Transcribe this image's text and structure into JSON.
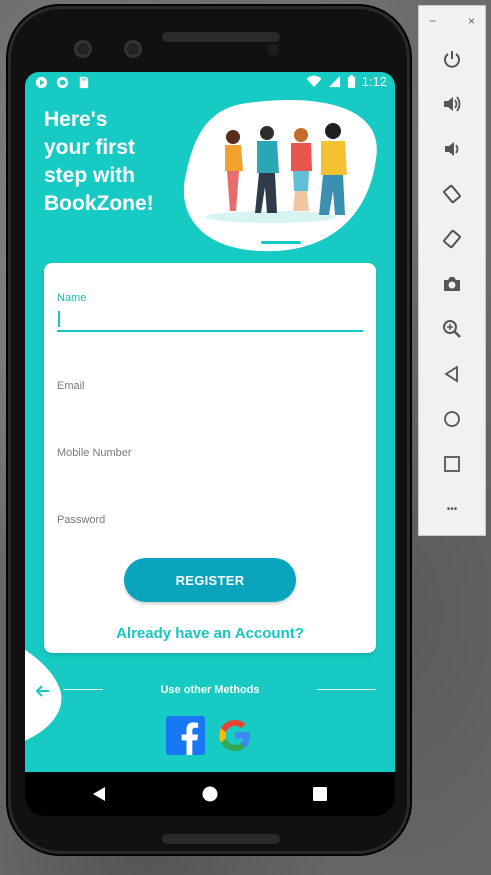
{
  "statusbar": {
    "time": "1:12"
  },
  "header": {
    "line1": "Here's",
    "line2": "your first",
    "line3": "step with",
    "line4": "BookZone!"
  },
  "form": {
    "name_label": "Name",
    "email_label": "Email",
    "mobile_label": "Mobile Number",
    "password_label": "Password",
    "register_label": "REGISTER",
    "login_link": "Already have an Account?"
  },
  "other": {
    "label": "Use other Methods"
  },
  "emulator": {
    "minimize": "−",
    "close": "×",
    "more": "•••"
  },
  "colors": {
    "accent": "#17cbc4",
    "button": "#0aa5bd",
    "link": "#17c6c0"
  },
  "icons": [
    "shield-icon",
    "sync-icon",
    "sdcard-icon",
    "wifi-icon",
    "signal-icon",
    "battery-icon",
    "facebook-icon",
    "google-icon",
    "back-arrow-icon",
    "power-icon",
    "volume-up-icon",
    "volume-down-icon",
    "rotate-left-icon",
    "rotate-right-icon",
    "camera-icon",
    "zoom-icon",
    "back-icon",
    "home-icon",
    "overview-icon",
    "more-icon"
  ]
}
